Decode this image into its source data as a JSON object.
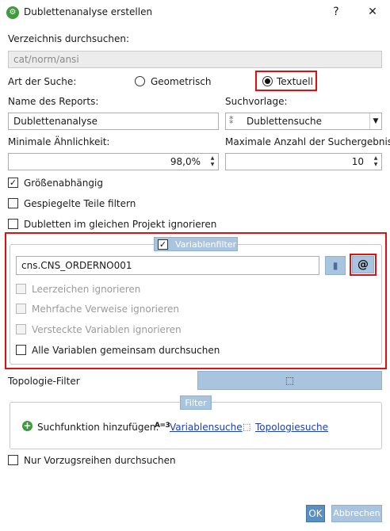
{
  "window": {
    "title": "Dublettenanalyse erstellen",
    "help": "?",
    "close": "✕"
  },
  "directory": {
    "label": "Verzeichnis durchsuchen:",
    "value": "cat/norm/ansi"
  },
  "search_type": {
    "label": "Art der Suche:",
    "geometric": "Geometrisch",
    "textual": "Textuell",
    "selected": "textual"
  },
  "report": {
    "label": "Name des Reports:",
    "value": "Dublettenanalyse"
  },
  "template": {
    "label": "Suchvorlage:",
    "value": "Dublettensuche"
  },
  "similarity": {
    "label": "Minimale Ähnlichkeit:",
    "value": "98,0%"
  },
  "max_results": {
    "label": "Maximale Anzahl der Suchergebnisse:",
    "value": "10"
  },
  "options": [
    {
      "label": "Größenabhängig",
      "checked": true
    },
    {
      "label": "Gespiegelte Teile filtern",
      "checked": false
    },
    {
      "label": "Dubletten im gleichen Projekt ignorieren",
      "checked": false
    }
  ],
  "variable_filter": {
    "legend": "Variablenfilter",
    "enabled": true,
    "value": "cns.CNS_ORDERNO001",
    "at_button": "@",
    "options": [
      {
        "label": "Leerzeichen ignorieren",
        "enabled": false
      },
      {
        "label": "Mehrfache Verweise ignorieren",
        "enabled": false
      },
      {
        "label": "Versteckte Variablen ignorieren",
        "enabled": false
      },
      {
        "label": "Alle Variablen gemeinsam durchsuchen",
        "enabled": true
      }
    ]
  },
  "topology": {
    "label": "Topologie-Filter"
  },
  "filter": {
    "legend": "Filter",
    "add_label": "Suchfunktion hinzufügen:",
    "variable_search_icon": "A=3",
    "variable_search": "Variablensuche",
    "topology_search": "Topologiesuche"
  },
  "preferred": {
    "label": "Nur Vorzugsreihen durchsuchen",
    "checked": false
  },
  "buttons": {
    "ok": "OK",
    "cancel": "Abbrechen"
  },
  "colors": {
    "highlight": "#e01010",
    "legend_bg": "#a9c4de",
    "ok_bg": "#5b8fc1",
    "link": "#1a3fbf"
  }
}
